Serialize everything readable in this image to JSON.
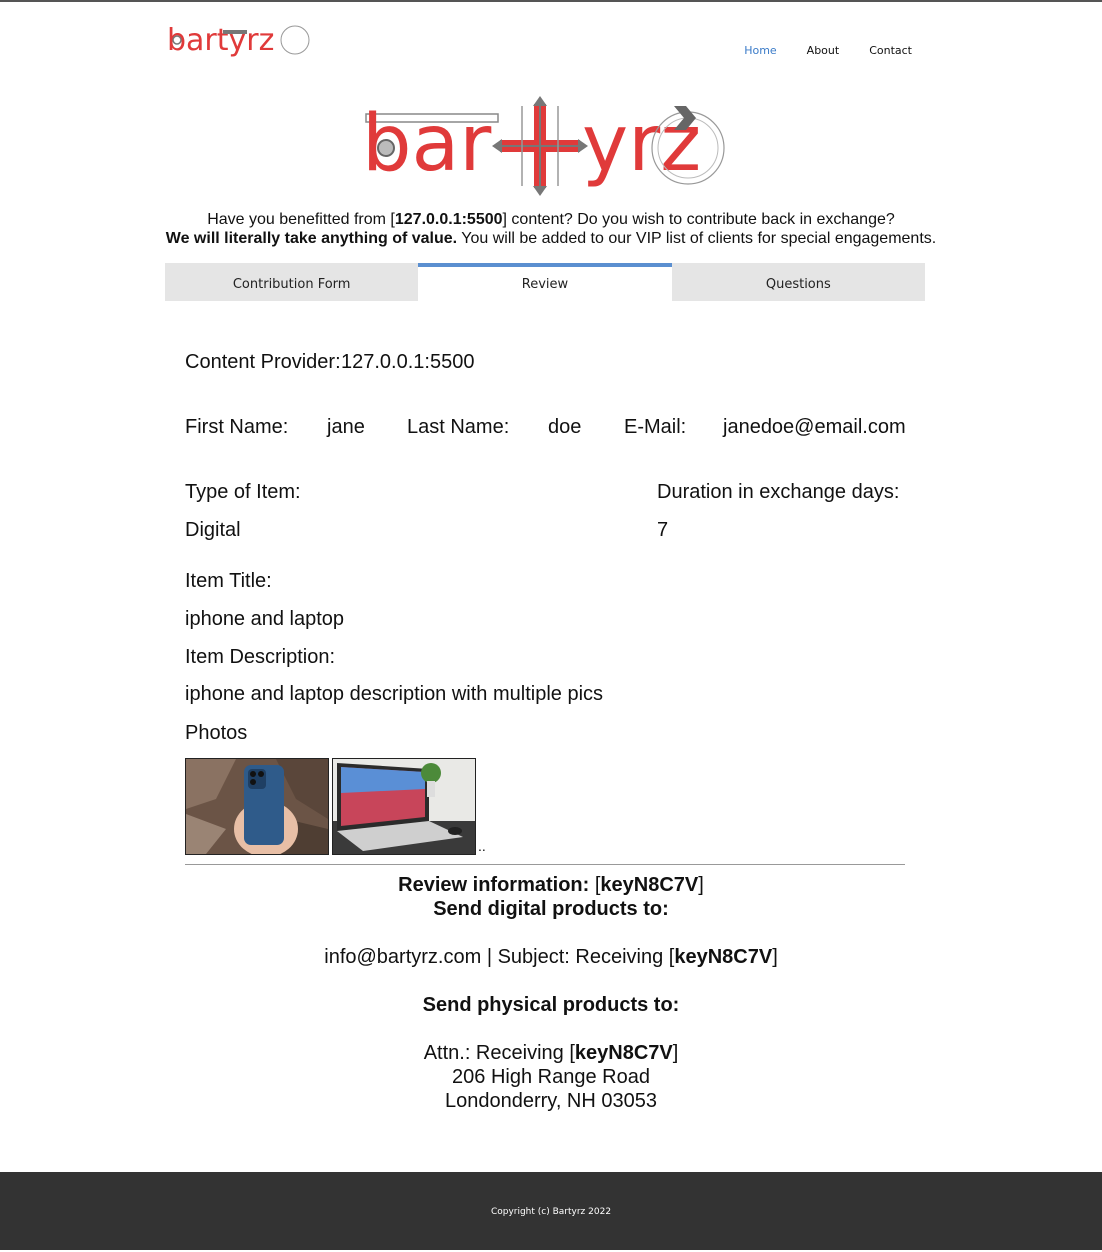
{
  "nav": {
    "items": [
      "Home",
      "About",
      "Contact"
    ]
  },
  "logo": {
    "text": "bartyrz"
  },
  "intro": {
    "line1_pre": "Have you benefitted from [",
    "line1_host": "127.0.0.1:5500",
    "line1_post": "] content? Do you wish to contribute back in exchange?",
    "line2_bold": "We will literally take anything of value.",
    "line2_rest": " You will be added to our VIP list of clients for special engagements."
  },
  "tabs": [
    "Contribution Form",
    "Review",
    "Questions"
  ],
  "review": {
    "provider_label": "Content Provider:",
    "provider_value": "127.0.0.1:5500",
    "first_name_label": "First Name:",
    "first_name_value": "jane",
    "last_name_label": "Last Name:",
    "last_name_value": "doe",
    "email_label": "E-Mail:",
    "email_value": "janedoe@email.com",
    "type_label": "Type of Item:",
    "type_value": "Digital",
    "duration_label": "Duration in exchange days:",
    "duration_value": "7",
    "title_label": "Item Title:",
    "title_value": "iphone and laptop",
    "desc_label": "Item Description:",
    "desc_value": "iphone and laptop description with multiple pics",
    "photos_label": "Photos",
    "photos_trailing": ".."
  },
  "info": {
    "review_label": "Review information:",
    "key": "keyN8C7V",
    "digital_heading": "Send digital products to:",
    "digital_line": "info@bartyrz.com | Subject: Receiving",
    "physical_heading": "Send physical products to:",
    "attn": "Attn.: Receiving",
    "address1": "206 High Range Road",
    "address2": "Londonderry, NH 03053"
  },
  "footer": {
    "copyright": "Copyright (c) Bartyrz 2022"
  },
  "colors": {
    "brand_red": "#e03a3a",
    "tab_active": "#5b8fd0",
    "nav_active": "#3a7bc8",
    "footer_bg": "#333333"
  }
}
